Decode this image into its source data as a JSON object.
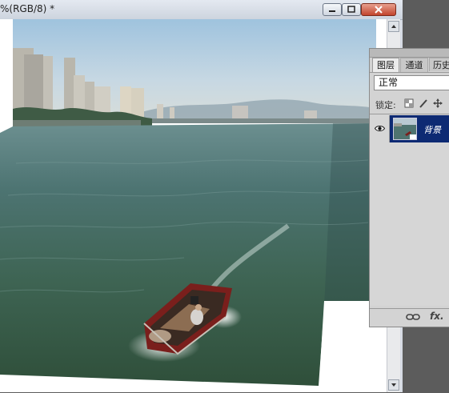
{
  "window": {
    "title": "%(RGB/8) *",
    "controls": [
      "minimize-icon",
      "maximize-icon",
      "close-icon"
    ]
  },
  "canvas": {
    "image": "photo of a small boat on open water with city skyline"
  },
  "layers_panel": {
    "tabs": [
      "图层",
      "通道",
      "历史"
    ],
    "blend_mode": "正常",
    "lock_label": "锁定:",
    "lock_icons": [
      "lock-transparent-icon",
      "lock-paint-icon",
      "lock-move-icon",
      "lock-all-icon"
    ],
    "layers": [
      {
        "name": "背景",
        "visible": true,
        "selected": true
      }
    ],
    "footer_icons": [
      "link-icon",
      "fx-icon"
    ]
  }
}
